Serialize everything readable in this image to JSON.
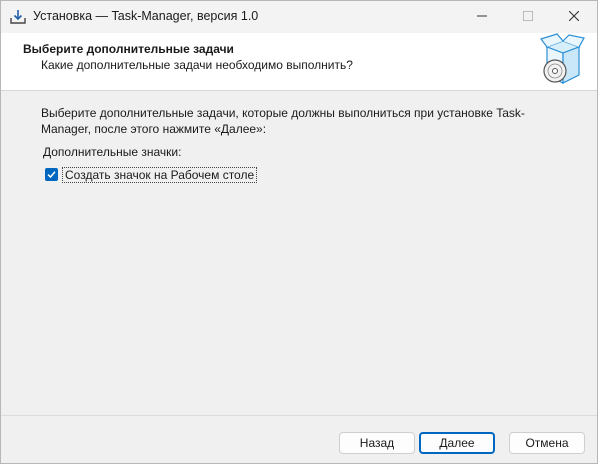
{
  "window": {
    "title": "Установка — Task-Manager, версия 1.0"
  },
  "header": {
    "title": "Выберите дополнительные задачи",
    "subtitle": "Какие дополнительные задачи необходимо выполнить?"
  },
  "content": {
    "intro": "Выберите дополнительные задачи, которые должны выполниться при установке Task-Manager, после этого нажмите «Далее»:",
    "group_label": "Дополнительные значки:",
    "tasks": [
      {
        "label": "Создать значок на Рабочем столе",
        "checked": true
      }
    ]
  },
  "buttons": {
    "back": "Назад",
    "next": "Далее",
    "cancel": "Отмена"
  },
  "colors": {
    "accent": "#0067c0",
    "header_bg": "#ffffff",
    "body_bg": "#f0f0f0"
  },
  "icons": {
    "app": "download-tray-icon",
    "wizard": "box-with-disc-icon"
  }
}
